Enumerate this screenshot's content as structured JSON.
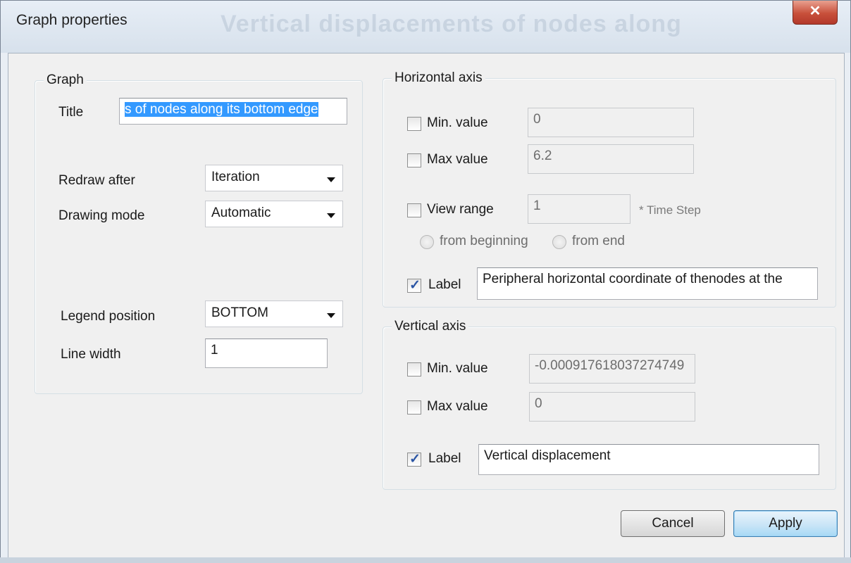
{
  "window": {
    "title": "Graph properties",
    "background_ghost_text": "Vertical displacements of nodes along",
    "close_glyph": "✕"
  },
  "graph_group": {
    "legend": "Graph",
    "title_label": "Title",
    "title_value": "s of nodes along its bottom edge",
    "redraw_label": "Redraw after",
    "redraw_value": "Iteration",
    "drawing_mode_label": "Drawing mode",
    "drawing_mode_value": "Automatic",
    "legend_position_label": "Legend position",
    "legend_position_value": "BOTTOM",
    "line_width_label": "Line width",
    "line_width_value": "1"
  },
  "horizontal_axis": {
    "legend": "Horizontal axis",
    "min_label": "Min. value",
    "min_checked": false,
    "min_value": "0",
    "max_label": "Max value",
    "max_checked": false,
    "max_value": "6.2",
    "view_range_label": "View range",
    "view_range_checked": false,
    "view_range_value": "1",
    "time_step_hint": "* Time Step",
    "from_beginning_label": "from beginning",
    "from_end_label": "from end",
    "label_label": "Label",
    "label_checked": true,
    "label_value": "Peripheral horizontal coordinate of thenodes at the"
  },
  "vertical_axis": {
    "legend": "Vertical axis",
    "min_label": "Min. value",
    "min_checked": false,
    "min_value": "-0.000917618037274749",
    "max_label": "Max value",
    "max_checked": false,
    "max_value": "0",
    "label_label": "Label",
    "label_checked": true,
    "label_value": "Vertical displacement"
  },
  "buttons": {
    "cancel": "Cancel",
    "apply": "Apply"
  }
}
